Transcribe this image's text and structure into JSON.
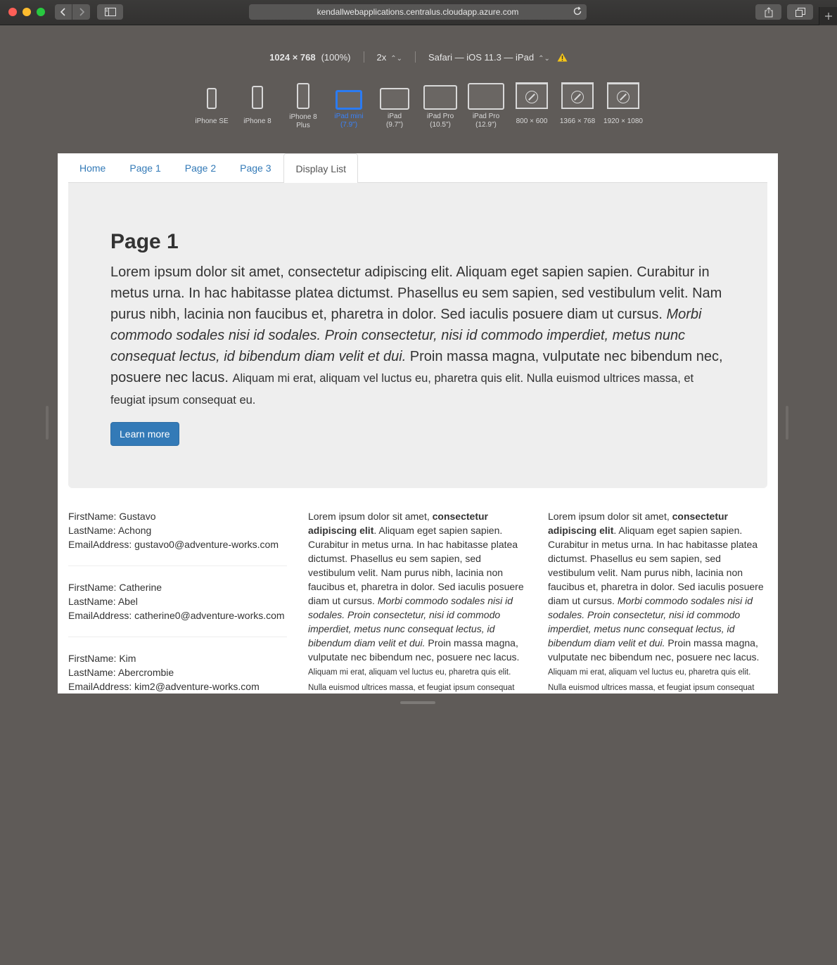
{
  "browser": {
    "url": "kendallwebapplications.centralus.cloudapp.azure.com"
  },
  "responsive": {
    "dimensions": "1024 × 768",
    "zoom": "(100%)",
    "scale": "2x",
    "user_agent": "Safari — iOS 11.3 — iPad",
    "devices": [
      {
        "label": "iPhone SE"
      },
      {
        "label": "iPhone 8"
      },
      {
        "label": "iPhone 8\nPlus"
      },
      {
        "label": "iPad mini\n(7.9\")"
      },
      {
        "label": "iPad\n(9.7\")"
      },
      {
        "label": "iPad Pro\n(10.5\")"
      },
      {
        "label": "iPad Pro\n(12.9\")"
      },
      {
        "label": "800 × 600"
      },
      {
        "label": "1366 × 768"
      },
      {
        "label": "1920 × 1080"
      }
    ],
    "selected_device": "iPad mini (7.9\")"
  },
  "page": {
    "nav": {
      "tabs": [
        "Home",
        "Page 1",
        "Page 2",
        "Page 3",
        "Display List"
      ],
      "active": "Display List"
    },
    "jumbotron": {
      "title": "Page 1",
      "lead_1": "Lorem ipsum dolor sit amet, ",
      "lead_bold": "consectetur adipiscing elit",
      "lead_2": ". Aliquam eget sapien sapien. Curabitur in metus urna. In hac habitasse platea dictumst. Phasellus eu sem sapien, sed vestibulum velit. Nam purus nibh, lacinia non faucibus et, pharetra in dolor. Sed iaculis posuere diam ut cursus. ",
      "lead_italic": "Morbi commodo sodales nisi id sodales. Proin consectetur, nisi id commodo imperdiet, metus nunc consequat lectus, id bibendum diam velit et dui.",
      "lead_3": " Proin massa magna, vulputate nec bibendum nec, posuere nec lacus. ",
      "lead_small": "Aliquam mi erat, aliquam vel luctus eu, pharetra quis elit. Nulla euismod ultrices massa, et feugiat ipsum consequat eu.",
      "button": "Learn more"
    },
    "people": [
      {
        "first": "FirstName: Gustavo",
        "last": "LastName: Achong",
        "email": "EmailAddress: gustavo0@adventure-works.com"
      },
      {
        "first": "FirstName: Catherine",
        "last": "LastName: Abel",
        "email": "EmailAddress: catherine0@adventure-works.com"
      },
      {
        "first": "FirstName: Kim",
        "last": "LastName: Abercrombie",
        "email": "EmailAddress: kim2@adventure-works.com"
      }
    ],
    "lorem": {
      "p1": "Lorem ipsum dolor sit amet, ",
      "bold": "consectetur adipiscing elit",
      "p2": ". Aliquam eget sapien sapien. Curabitur in metus urna. In hac habitasse platea dictumst. Phasellus eu sem sapien, sed vestibulum velit. Nam purus nibh, lacinia non faucibus et, pharetra in dolor. Sed iaculis posuere diam ut cursus. ",
      "italic": "Morbi commodo sodales nisi id sodales. Proin consectetur, nisi id commodo imperdiet, metus nunc consequat lectus, id bibendum diam velit et dui.",
      "p3": " Proin massa magna, vulputate nec bibendum nec, posuere nec lacus. ",
      "small": "Aliquam mi erat, aliquam vel luctus eu, pharetra quis elit. Nulla euismod ultrices massa, et feugiat ipsum consequat eu."
    }
  },
  "colors": {
    "link": "#337ab7",
    "jumbotron_bg": "#eeeeee",
    "selected_device": "#2b7bf2"
  }
}
